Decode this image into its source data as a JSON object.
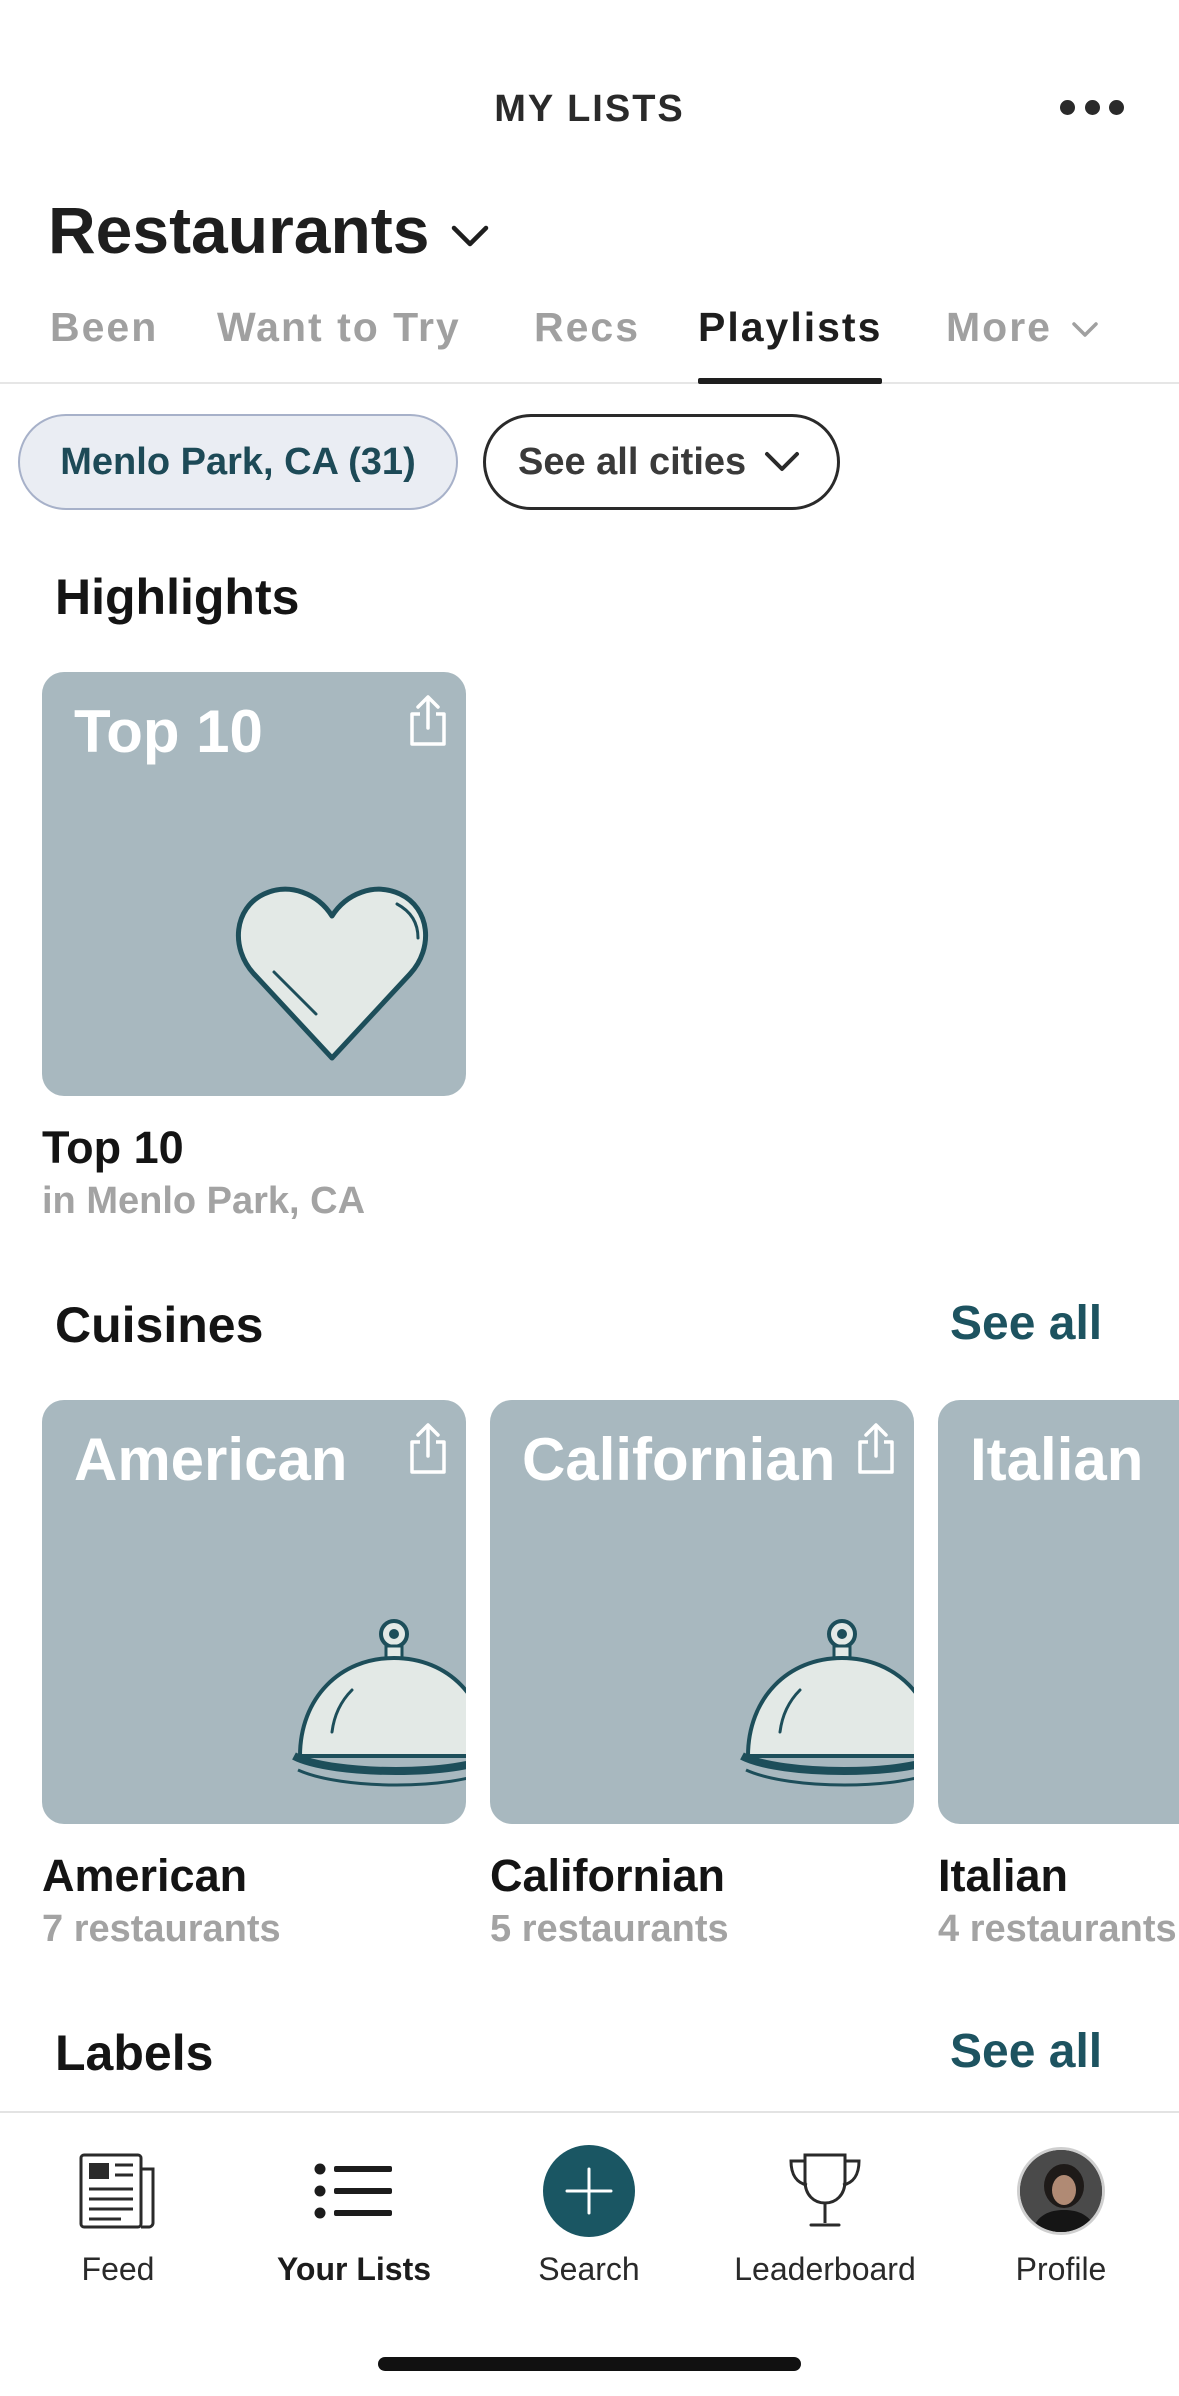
{
  "header": {
    "title": "MY LISTS",
    "more_icon": "more-horizontal-icon"
  },
  "page": {
    "title": "Restaurants"
  },
  "tabs": [
    {
      "label": "Been",
      "active": false
    },
    {
      "label": "Want to Try",
      "active": false
    },
    {
      "label": "Recs",
      "active": false
    },
    {
      "label": "Playlists",
      "active": true
    },
    {
      "label": "More",
      "active": false
    }
  ],
  "filters": {
    "city": "Menlo Park, CA (31)",
    "all_cities": "See all cities"
  },
  "highlights": {
    "title": "Highlights",
    "items": [
      {
        "card_title": "Top 10",
        "name": "Top 10",
        "subtitle": "in Menlo Park, CA"
      }
    ]
  },
  "cuisines": {
    "title": "Cuisines",
    "see_all": "See all",
    "items": [
      {
        "card_title": "American",
        "name": "American",
        "subtitle": "7 restaurants"
      },
      {
        "card_title": "Californian",
        "name": "Californian",
        "subtitle": "5 restaurants"
      },
      {
        "card_title": "Italian",
        "name": "Italian",
        "subtitle": "4 restaurants"
      }
    ]
  },
  "labels": {
    "title": "Labels",
    "see_all": "See all"
  },
  "colors": {
    "accent": "#1a5663",
    "card_bg": "#a8b8bf",
    "chip_bg": "#eaedf3"
  },
  "bottom_nav": [
    {
      "label": "Feed",
      "icon": "newspaper-icon"
    },
    {
      "label": "Your Lists",
      "icon": "list-icon",
      "active": true
    },
    {
      "label": "Search",
      "icon": "plus-icon"
    },
    {
      "label": "Leaderboard",
      "icon": "trophy-icon"
    },
    {
      "label": "Profile",
      "icon": "avatar"
    }
  ]
}
